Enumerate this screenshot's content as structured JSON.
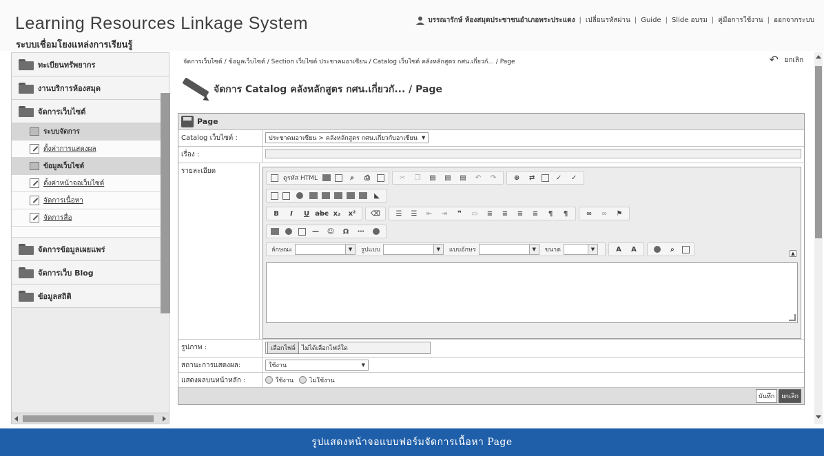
{
  "header": {
    "title": "Learning Resources Linkage System",
    "subtitle": "ระบบเชื่อมโยงแหล่งการเรียนรู้",
    "user_name": "บรรณารักษ์ ห้องสมุดประชาชนอำเภอพระประแดง",
    "nav": [
      "เปลี่ยนรหัสผ่าน",
      "Guide",
      "Slide อบรม",
      "คู่มือการใช้งาน",
      "ออกจากระบบ"
    ]
  },
  "sidebar": {
    "items": [
      {
        "label": "ทะเบียนทรัพยากร"
      },
      {
        "label": "งานบริการห้องสมุด"
      },
      {
        "label": "จัดการเว็บไซต์"
      }
    ],
    "sub_items": [
      {
        "label": "ระบบจัดการ",
        "header": true
      },
      {
        "label": "ตั้งค่าการแสดงผล"
      },
      {
        "label": "ข้อมูลเว็บไซต์",
        "header": true
      },
      {
        "label": "ตั้งค่าหน้าจอเว็บไซต์"
      },
      {
        "label": "จัดการเนื้อหา"
      },
      {
        "label": "จัดการสื่อ"
      }
    ],
    "items_after": [
      {
        "label": "จัดการข้อมูลเผยแพร่"
      },
      {
        "label": "จัดการเว็บ Blog"
      },
      {
        "label": "ข้อมูลสถิติ"
      }
    ]
  },
  "main": {
    "breadcrumb": "จัดการเว็บไซต์ / ข้อมูลเว็บไซต์ / Section เว็บไซต์ ประชาคมอาเซียน / Catalog เว็บไซต์ คลังหลักสูตร กศน.เกี่ยวกั... / Page",
    "cancel_label": "ยกเลิก",
    "page_title": "จัดการ Catalog คลังหลักสูตร กศน.เกี่ยวกั... / Page"
  },
  "form": {
    "header": "Page",
    "catalog_label": "Catalog เว็บไซต์ :",
    "catalog_value": "ประชาคมอาเซียน > คลังหลักสูตร กศน.เกี่ยวกับอาเซียน",
    "subject_label": "เรื่อง :",
    "subject_value": "",
    "detail_label": "รายละเอียด",
    "image_label": "รูปภาพ :",
    "file_button": "เลือกไฟล์",
    "file_status": "ไม่ได้เลือกไฟล์ใด",
    "status_label": "สถานะการแสดงผล:",
    "status_value": "ใช้งาน",
    "homepage_label": "แสดงผลบนหน้าหลัก :",
    "homepage_options": [
      "ใช้งาน",
      "ไม่ใช้งาน"
    ],
    "save_button": "บันทึก",
    "cancel_button": "ยกเลิก"
  },
  "editor": {
    "source_label": "ดูรหัส HTML",
    "style_label": "ลักษณะ",
    "format_label": "รูปแบบ",
    "font_label": "แบบอักษร",
    "size_label": "ขนาด"
  },
  "caption": "รูปแสดงหน้าจอแบบฟอร์มจัดการเนื้อหา Page",
  "colors": {
    "caption_bg": "#1f5fa9",
    "sidebar_bg": "#ececec",
    "form_header_bg": "#e6e6e6"
  }
}
